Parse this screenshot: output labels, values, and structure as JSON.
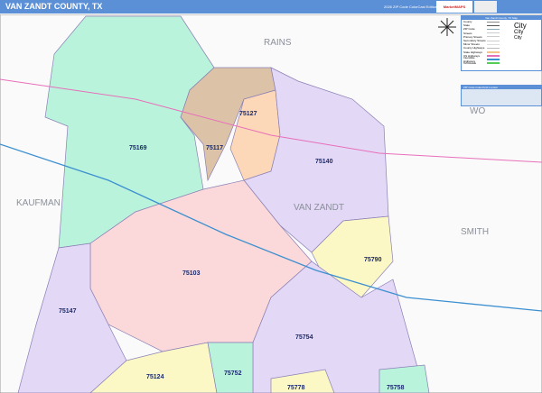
{
  "header": {
    "title": "VAN ZANDT COUNTY, TX",
    "edition": "2026 ZIP Code ColorCast Edition",
    "logo": "MarketMAPS"
  },
  "counties": [
    "RAINS",
    "KAUFMAN",
    "VAN ZANDT",
    "SMITH",
    "WO"
  ],
  "zips": [
    "75117",
    "75127",
    "75169",
    "75140",
    "75103",
    "75790",
    "75147",
    "75754",
    "75124",
    "75752",
    "75778",
    "75758"
  ],
  "legend": {
    "title": "Van Zandt County, TX Map",
    "items": [
      "County",
      "State",
      "ZIP Code",
      "Streets",
      "Primary Streets",
      "Secondary Streets",
      "Minor Streets",
      "County Highways",
      "State Highways",
      "US Highways",
      "Interstate Highways",
      "Toll Roads"
    ],
    "cities": [
      "City",
      "City",
      "City"
    ]
  },
  "zip_index": {
    "title": "ZIP Code Index/Grid Locator"
  },
  "colors": {
    "header": "#5b8fd6",
    "green": "#b9f3dc",
    "brown": "#dcc3a8",
    "orange": "#fcd7b8",
    "lavender": "#e3d8f6",
    "pink": "#fbd9da",
    "yellow": "#fbf8c6"
  }
}
